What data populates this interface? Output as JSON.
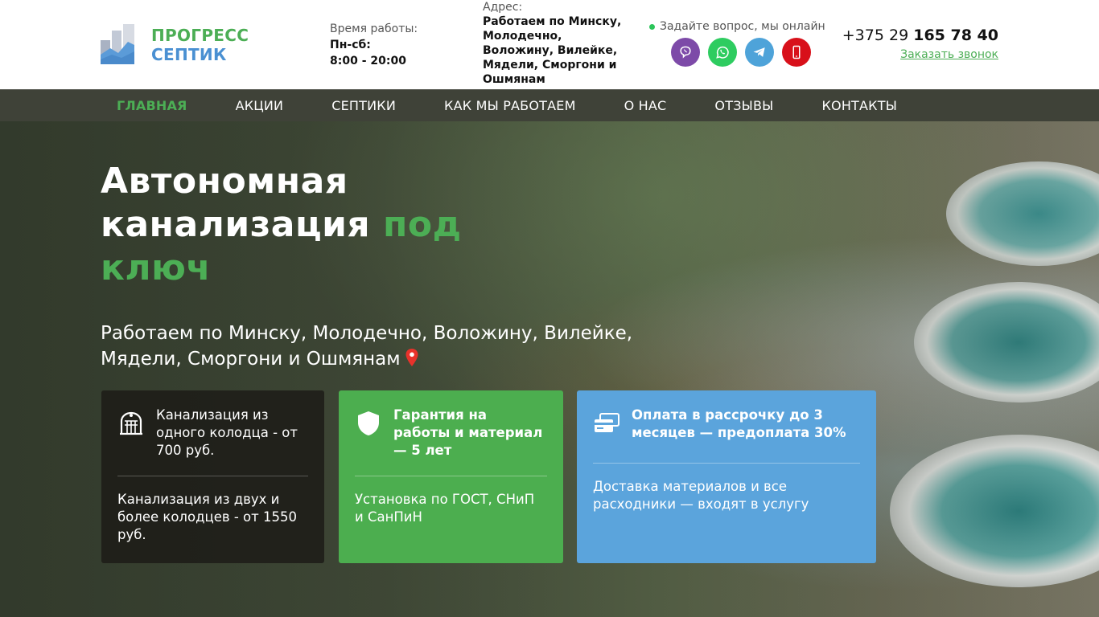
{
  "brand": {
    "line1": "ПРОГРЕСС",
    "line2": "СЕПТИК",
    "colors": {
      "green": "#4cae55",
      "blue": "#4a90d2"
    }
  },
  "header": {
    "hours_label": "Время работы:",
    "hours_days": "Пн-сб:",
    "hours_time": "8:00 - 20:00",
    "address_label": "Адрес:",
    "address_value": "Работаем по Минску, Молодечно, Воложину, Вилейке, Мядели, Сморгони и Ошмянам",
    "online_text": "Задайте вопрос, мы онлайн",
    "messengers": [
      "viber-icon",
      "whatsapp-icon",
      "telegram-icon",
      "mobile-phone-icon"
    ],
    "phone_prefix": "+375 29",
    "phone_number": "165 78 40",
    "callback_label": "Заказать звонок"
  },
  "nav": {
    "items": [
      "ГЛАВНАЯ",
      "АКЦИИ",
      "СЕПТИКИ",
      "КАК МЫ РАБОТАЕМ",
      "О НАС",
      "ОТЗЫВЫ",
      "КОНТАКТЫ"
    ],
    "active_index": 0
  },
  "hero": {
    "title_part1": "Автономная канализация",
    "title_accent": "под ключ",
    "subtitle": "Работаем по Минску, Молодечно, Воложину, Вилейке, Мядели, Сморгони и Ошмянам"
  },
  "cards": [
    {
      "icon": "sewer-well-icon",
      "head": "Канализация из одного колодца - от 700 руб.",
      "body": "Канализация из двух и более колодцев - от 1550 руб."
    },
    {
      "icon": "shield-icon",
      "head": "Гарантия на работы и материал — 5 лет",
      "body": "Установка по ГОСТ, СНиП и СанПиН"
    },
    {
      "icon": "credit-cards-icon",
      "head": "Оплата в рассрочку до 3 месяцев — предоплата 30%",
      "body": "Доставка материалов и все расходники — входят в услугу"
    }
  ]
}
